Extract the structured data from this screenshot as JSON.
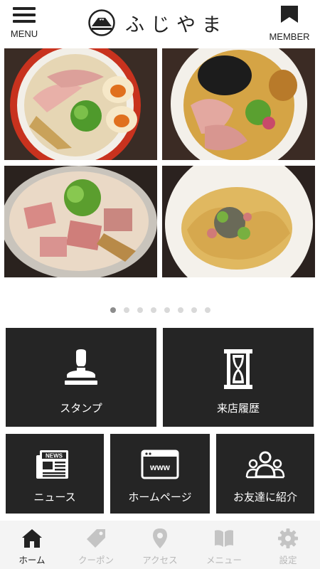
{
  "header": {
    "menu_label": "MENU",
    "brand_name": "ふじやま",
    "member_label": "MEMBER"
  },
  "carousel": {
    "page_count": 8,
    "active_index": 0
  },
  "tiles": {
    "stamp": "スタンプ",
    "history": "来店履歴",
    "news": "ニュース",
    "homepage": "ホームページ",
    "friend": "お友達に紹介",
    "news_icon_text": "NEWS",
    "www_icon_text": "www"
  },
  "bottom_nav": {
    "items": [
      {
        "label": "ホーム",
        "icon": "home-icon",
        "active": true
      },
      {
        "label": "クーポン",
        "icon": "coupon-tag-icon",
        "active": false
      },
      {
        "label": "アクセス",
        "icon": "map-pin-icon",
        "active": false
      },
      {
        "label": "メニュー",
        "icon": "book-icon",
        "active": false
      },
      {
        "label": "設定",
        "icon": "gear-icon",
        "active": false
      }
    ]
  },
  "colors": {
    "tile_bg": "#252525",
    "nav_bg": "#f4f4f4",
    "nav_inactive": "#b8b8b8",
    "text_dark": "#222222"
  }
}
